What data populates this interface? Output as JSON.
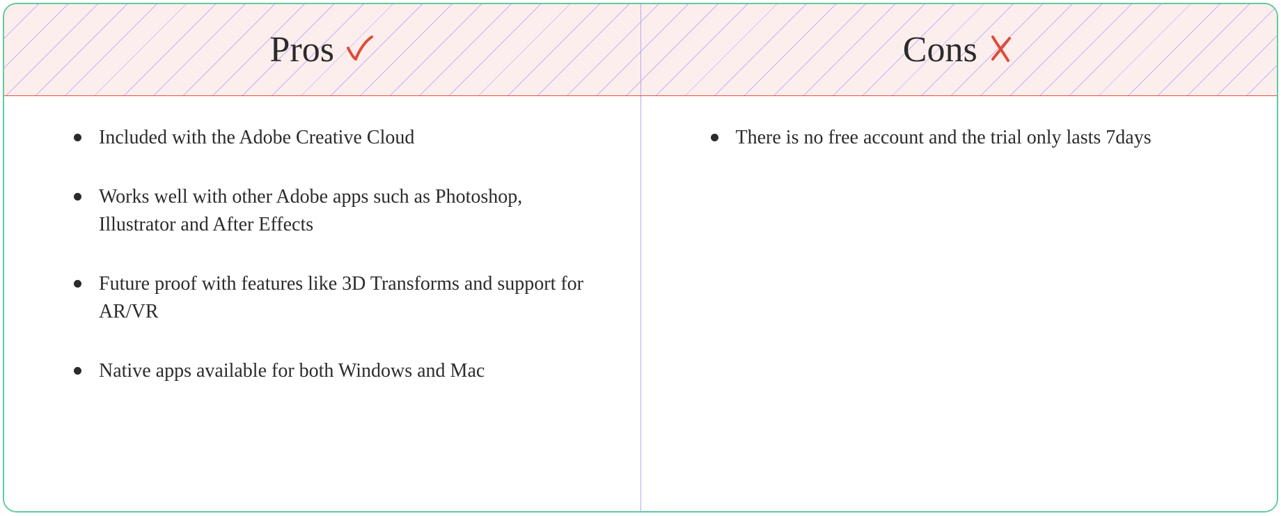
{
  "headers": {
    "pros": "Pros",
    "cons": "Cons"
  },
  "pros": [
    "Included with the Adobe Creative Cloud",
    "Works well with other Adobe apps such as Photoshop, Illustrator and After Effects",
    "Future proof with features like 3D Transforms and support for AR/VR",
    "Native apps available for both Windows and Mac"
  ],
  "cons": [
    "There is no free account and the trial only lasts 7days"
  ]
}
